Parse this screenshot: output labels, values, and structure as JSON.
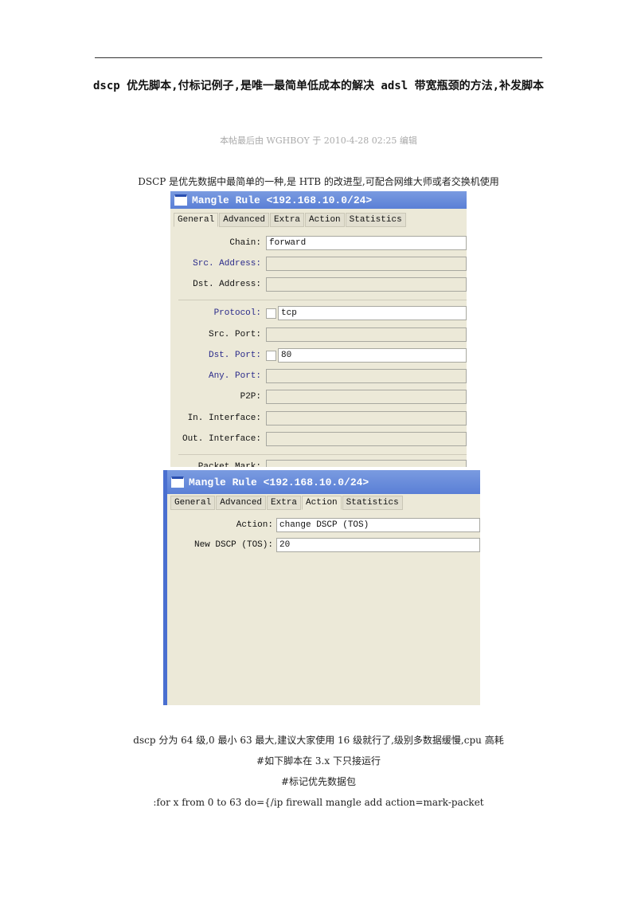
{
  "title": "dscp 优先脚本,付标记例子,是唯一最简单低成本的解决 adsl 带宽瓶颈的方法,补发脚本",
  "meta": "本帖最后由 WGHBOY 于 2010-4-28 02:25 编辑",
  "intro": "DSCP 是优先数据中最简单的一种,是 HTB 的改进型,可配合网维大师或者交换机使用",
  "shot1": {
    "title": "Mangle Rule <192.168.10.0/24>",
    "tabs": [
      "General",
      "Advanced",
      "Extra",
      "Action",
      "Statistics"
    ],
    "active_tab": "General",
    "fields": [
      {
        "label": "Chain:",
        "value": "forward"
      },
      {
        "label": "Src. Address:",
        "value": ""
      },
      {
        "label": "Dst. Address:",
        "value": ""
      },
      {
        "label": "Protocol:",
        "value": "tcp"
      },
      {
        "label": "Src. Port:",
        "value": ""
      },
      {
        "label": "Dst. Port:",
        "value": "80"
      },
      {
        "label": "Any. Port:",
        "value": ""
      },
      {
        "label": "P2P:",
        "value": ""
      },
      {
        "label": "In. Interface:",
        "value": ""
      },
      {
        "label": "Out. Interface:",
        "value": ""
      },
      {
        "label": "Packet Mark:",
        "value": ""
      }
    ]
  },
  "shot2": {
    "title": "Mangle Rule <192.168.10.0/24>",
    "tabs": [
      "General",
      "Advanced",
      "Extra",
      "Action",
      "Statistics"
    ],
    "active_tab": "Action",
    "fields": [
      {
        "label": "Action:",
        "value": "change DSCP (TOS)"
      },
      {
        "label": "New DSCP (TOS):",
        "value": "20"
      }
    ]
  },
  "lines": [
    "dscp 分为 64 级,0 最小 63 最大,建议大家使用 16 级就行了,级别多数据缓慢,cpu 高耗",
    "#如下脚本在 3.x 下只接运行",
    "#标记优先数据包",
    ":for x from 0 to 63 do={/ip firewall mangle add action=mark-packet"
  ]
}
